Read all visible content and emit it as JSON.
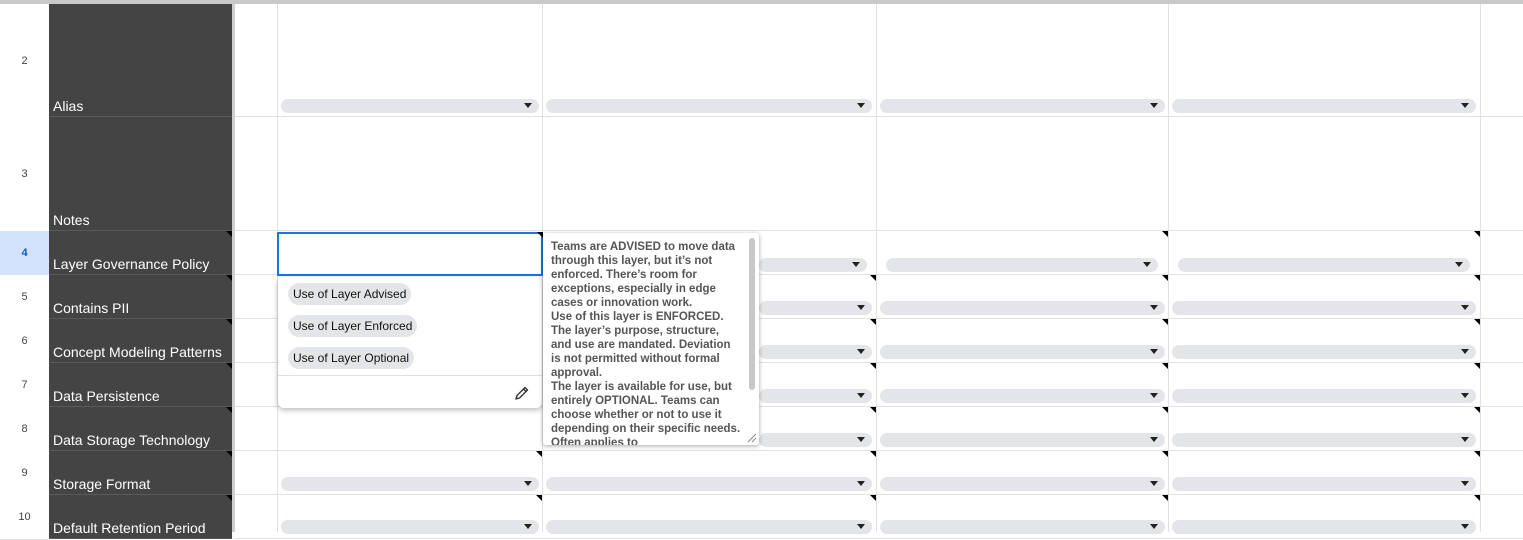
{
  "sheet": {
    "rows": [
      {
        "number": "2",
        "label": "Alias"
      },
      {
        "number": "3",
        "label": "Notes"
      },
      {
        "number": "4",
        "label": "Layer Governance Policy"
      },
      {
        "number": "5",
        "label": "Contains PII"
      },
      {
        "number": "6",
        "label": "Concept Modeling Patterns"
      },
      {
        "number": "7",
        "label": "Data Persistence"
      },
      {
        "number": "8",
        "label": "Data Storage Technology"
      },
      {
        "number": "9",
        "label": "Storage Format"
      },
      {
        "number": "10",
        "label": "Default Retention Period"
      }
    ]
  },
  "dropdown": {
    "options": [
      "Use of Layer Advised",
      "Use of Layer Enforced",
      "Use of Layer Optional"
    ],
    "edit_icon": "pencil-icon"
  },
  "tooltip": {
    "paragraphs": [
      "Teams are ADVISED to move data through this layer, but it’s not enforced. There’s room for exceptions, especially in edge cases or innovation work.",
      "Use of this layer is ENFORCED. The layer’s purpose, structure, and use are mandated. Deviation is not permitted without formal approval.",
      "The layer is available for use, but entirely OPTIONAL. Teams can choose whether or not to use it depending on their specific needs. Often applies to"
    ]
  },
  "colors": {
    "label_bg": "#444444",
    "selection_border": "#1a73e8",
    "chip_bg": "#e3e5e8",
    "selected_row_bg": "#d3e3fd"
  }
}
